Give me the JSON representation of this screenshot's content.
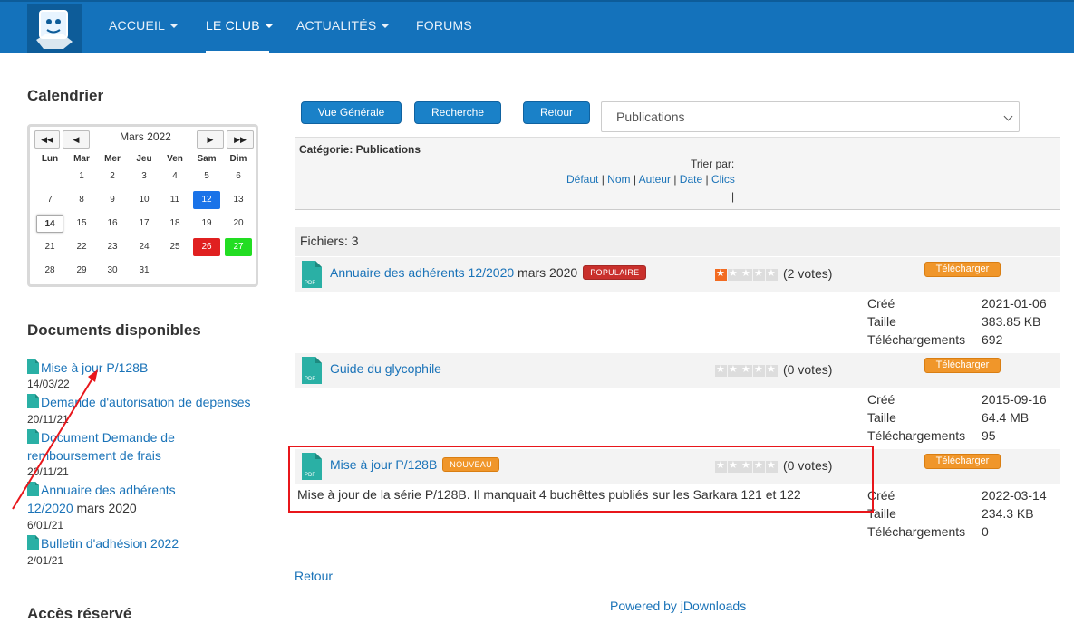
{
  "nav": {
    "items": [
      {
        "label": "ACCUEIL",
        "dropdown": true
      },
      {
        "label": "LE CLUB",
        "dropdown": true,
        "active": true
      },
      {
        "label": "ACTUALITÉS",
        "dropdown": true
      },
      {
        "label": "FORUMS",
        "dropdown": false
      }
    ]
  },
  "sidebar": {
    "calendar_title": "Calendrier",
    "calendar": {
      "month": "Mars 2022",
      "nav": {
        "prev_year": "◀◀",
        "prev_month": "◀",
        "next_month": "▶",
        "next_year": "▶▶"
      },
      "weekdays": [
        "Lun",
        "Mar",
        "Mer",
        "Jeu",
        "Ven",
        "Sam",
        "Dim"
      ],
      "weeks": [
        [
          "",
          "1",
          "2",
          "3",
          "4",
          "5",
          "6"
        ],
        [
          "7",
          "8",
          "9",
          "10",
          "11",
          "12",
          "13"
        ],
        [
          "14",
          "15",
          "16",
          "17",
          "18",
          "19",
          "20"
        ],
        [
          "21",
          "22",
          "23",
          "24",
          "25",
          "26",
          "27"
        ],
        [
          "28",
          "29",
          "30",
          "31",
          "",
          "",
          ""
        ]
      ],
      "today": "14",
      "highlights": {
        "12": "#1a73e8",
        "26": "#e02020",
        "27": "#22dd22"
      }
    },
    "documents_title": "Documents disponibles",
    "documents": [
      {
        "title": "Mise à jour P/128B",
        "date": "14/03/22"
      },
      {
        "title": "Demande d'autorisation de depenses",
        "date": "20/11/21"
      },
      {
        "title_line1": "Document Demande de",
        "title_line2": "remboursement de frais",
        "date": "20/11/21"
      },
      {
        "title_line1": "Annuaire des adhérents",
        "title_line2": "12/2020",
        "suffix": " mars 2020",
        "date": "6/01/21"
      },
      {
        "title": "Bulletin d'adhésion 2022",
        "date": "2/01/21"
      }
    ],
    "reserved_title": "Accès réservé"
  },
  "toolbar": {
    "overview": "Vue Générale",
    "search": "Recherche",
    "back": "Retour",
    "category_select": "Publications"
  },
  "category": {
    "title": "Catégorie: Publications",
    "sort_label": "Trier par:",
    "sort_links": [
      "Défaut",
      "Nom",
      "Auteur",
      "Date",
      "Clics"
    ],
    "sort_bar": "|"
  },
  "files": {
    "count_label": "Fichiers: 3",
    "download_label": "Télécharger",
    "meta_labels": {
      "created": "Créé",
      "size": "Taille",
      "downloads": "Téléchargements"
    },
    "items": [
      {
        "title": "Annuaire des adhérents 12/2020",
        "suffix": " mars 2020",
        "badge": "POPULAIRE",
        "badge_color": "#c9302c",
        "rating": 1,
        "votes": "(2 votes)",
        "created": "2021-01-06",
        "size": "383.85 KB",
        "downloads": "692"
      },
      {
        "title": "Guide du glycophile",
        "rating": 0,
        "votes": "(0 votes)",
        "created": "2015-09-16",
        "size": "64.4 MB",
        "downloads": "95"
      },
      {
        "title": "Mise à jour P/128B",
        "badge": "NOUVEAU",
        "badge_color": "#f0962a",
        "rating": 0,
        "votes": "(0 votes)",
        "description": "Mise à jour de la série P/128B. Il manquait 4 buchêttes publiés sur les Sarkara 121 et 122",
        "created": "2022-03-14",
        "size": "234.3 KB",
        "downloads": "0"
      }
    ]
  },
  "footer": {
    "back": "Retour",
    "powered": "Powered by jDownloads"
  },
  "colors": {
    "brand": "#1472bb",
    "link": "#1a73b8",
    "annotation": "#e8161b"
  }
}
